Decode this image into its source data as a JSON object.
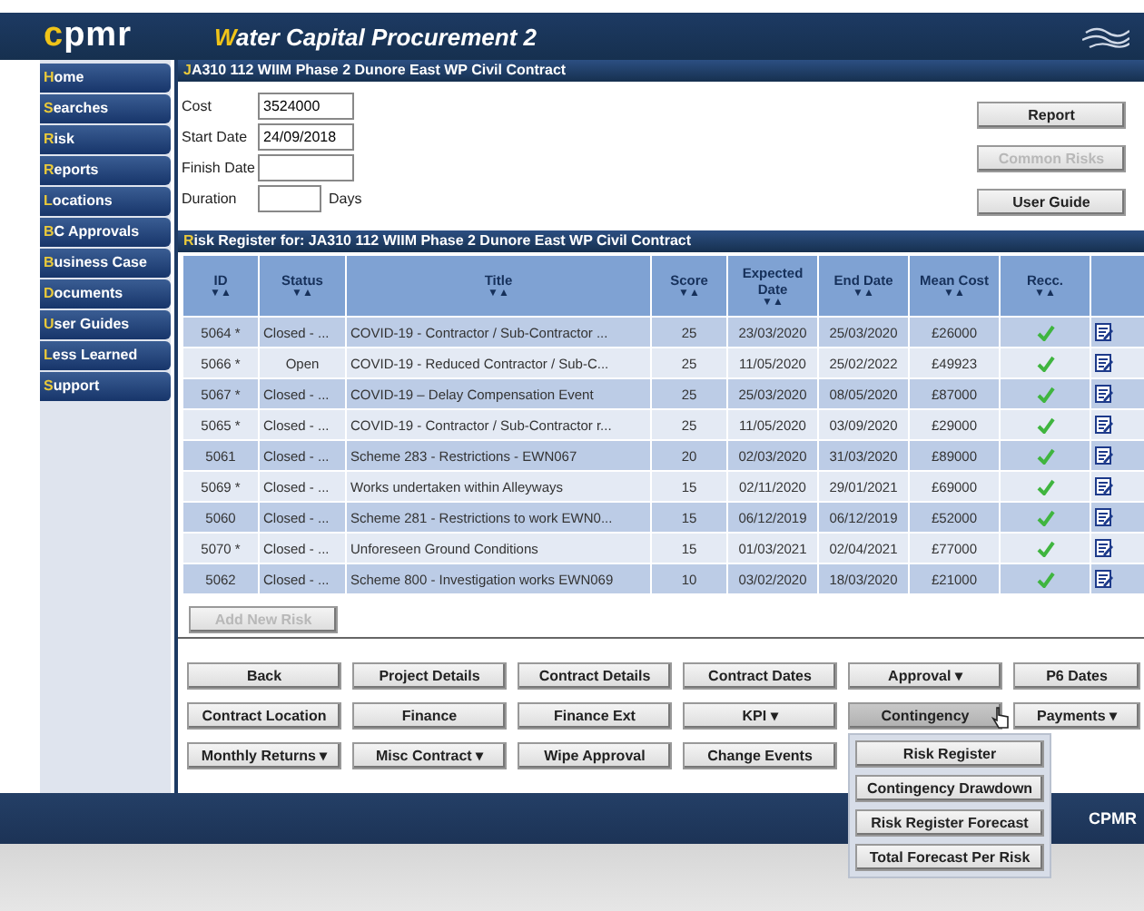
{
  "header": {
    "logo": "cpmr",
    "title": "Water Capital Procurement 2"
  },
  "sidebar": {
    "items": [
      {
        "label": "Home"
      },
      {
        "label": "Searches"
      },
      {
        "label": "Risk"
      },
      {
        "label": "Reports"
      },
      {
        "label": "Locations"
      },
      {
        "label": "BC Approvals"
      },
      {
        "label": "Business Case"
      },
      {
        "label": "Documents"
      },
      {
        "label": "User Guides"
      },
      {
        "label": "Less Learned"
      },
      {
        "label": "Support"
      }
    ]
  },
  "project": {
    "title": "JA310 112 WIIM Phase 2 Dunore East WP Civil Contract",
    "fields": [
      {
        "label": "Cost",
        "value": "3524000",
        "kind": "text"
      },
      {
        "label": "Start Date",
        "value": "24/09/2018",
        "kind": "text"
      },
      {
        "label": "Finish Date",
        "kind": "text"
      },
      {
        "label": "Duration",
        "unit": "Days",
        "kind": "short"
      }
    ],
    "buttons": [
      {
        "label": "Report",
        "disabled": false
      },
      {
        "label": "Common Risks",
        "disabled": true
      },
      {
        "label": "User Guide",
        "disabled": false
      }
    ]
  },
  "register": {
    "title": "Risk Register for: JA310 112 WIIM Phase 2 Dunore East WP Civil Contract",
    "sort_marker": "▼▲",
    "columns": [
      "ID",
      "Status",
      "Title",
      "Score",
      "Expected Date",
      "End Date",
      "Mean Cost",
      "Recc.",
      ""
    ],
    "rows": [
      {
        "id": "5064 *",
        "status": "Closed - ...",
        "title": "COVID-19 - Contractor / Sub-Contractor ...",
        "score": "25",
        "expected": "23/03/2020",
        "end": "25/03/2020",
        "cost": "£26000",
        "recc": true
      },
      {
        "id": "5066 *",
        "status": "Open",
        "title": "COVID-19 - Reduced Contractor / Sub-C...",
        "score": "25",
        "expected": "11/05/2020",
        "end": "25/02/2022",
        "cost": "£49923",
        "recc": true
      },
      {
        "id": "5067 *",
        "status": "Closed - ...",
        "title": "COVID-19 – Delay Compensation Event",
        "score": "25",
        "expected": "25/03/2020",
        "end": "08/05/2020",
        "cost": "£87000",
        "recc": true
      },
      {
        "id": "5065 *",
        "status": "Closed - ...",
        "title": "COVID-19 - Contractor / Sub-Contractor r...",
        "score": "25",
        "expected": "11/05/2020",
        "end": "03/09/2020",
        "cost": "£29000",
        "recc": true
      },
      {
        "id": "5061",
        "status": "Closed - ...",
        "title": "Scheme 283 - Restrictions - EWN067",
        "score": "20",
        "expected": "02/03/2020",
        "end": "31/03/2020",
        "cost": "£89000",
        "recc": true
      },
      {
        "id": "5069 *",
        "status": "Closed - ...",
        "title": "Works undertaken within Alleyways",
        "score": "15",
        "expected": "02/11/2020",
        "end": "29/01/2021",
        "cost": "£69000",
        "recc": true
      },
      {
        "id": "5060",
        "status": "Closed - ...",
        "title": "Scheme 281 - Restrictions to work EWN0...",
        "score": "15",
        "expected": "06/12/2019",
        "end": "06/12/2019",
        "cost": "£52000",
        "recc": true
      },
      {
        "id": "5070 *",
        "status": "Closed - ...",
        "title": "Unforeseen Ground Conditions",
        "score": "15",
        "expected": "01/03/2021",
        "end": "02/04/2021",
        "cost": "£77000",
        "recc": true
      },
      {
        "id": "5062",
        "status": "Closed - ...",
        "title": "Scheme 800 - Investigation works EWN069",
        "score": "10",
        "expected": "03/02/2020",
        "end": "18/03/2020",
        "cost": "£21000",
        "recc": true
      }
    ],
    "add_button": {
      "label": "Add New Risk",
      "disabled": true
    }
  },
  "nav_buttons": [
    {
      "label": "Back",
      "expanded": false
    },
    {
      "label": "Project Details",
      "expanded": false
    },
    {
      "label": "Contract Details",
      "expanded": false
    },
    {
      "label": "Contract Dates",
      "expanded": false
    },
    {
      "label": "Approval ▾",
      "expanded": false
    },
    {
      "label": "P6 Dates",
      "expanded": false
    },
    {
      "label": "Contract Location",
      "expanded": false
    },
    {
      "label": "Finance",
      "expanded": false
    },
    {
      "label": "Finance Ext",
      "expanded": false
    },
    {
      "label": "KPI ▾",
      "expanded": false
    },
    {
      "label": "Contingency",
      "expanded": true,
      "menu": [
        "Risk Register",
        "Contingency Drawdown",
        "Risk Register Forecast",
        "Total Forecast Per Risk"
      ]
    },
    {
      "label": "Payments ▾",
      "expanded": false
    },
    {
      "label": "Monthly Returns ▾",
      "expanded": false
    },
    {
      "label": "Misc Contract ▾",
      "expanded": false
    },
    {
      "label": "Wipe Approval",
      "expanded": false
    },
    {
      "label": "Change Events",
      "expanded": false
    }
  ],
  "footer": {
    "text": "CPMR"
  }
}
